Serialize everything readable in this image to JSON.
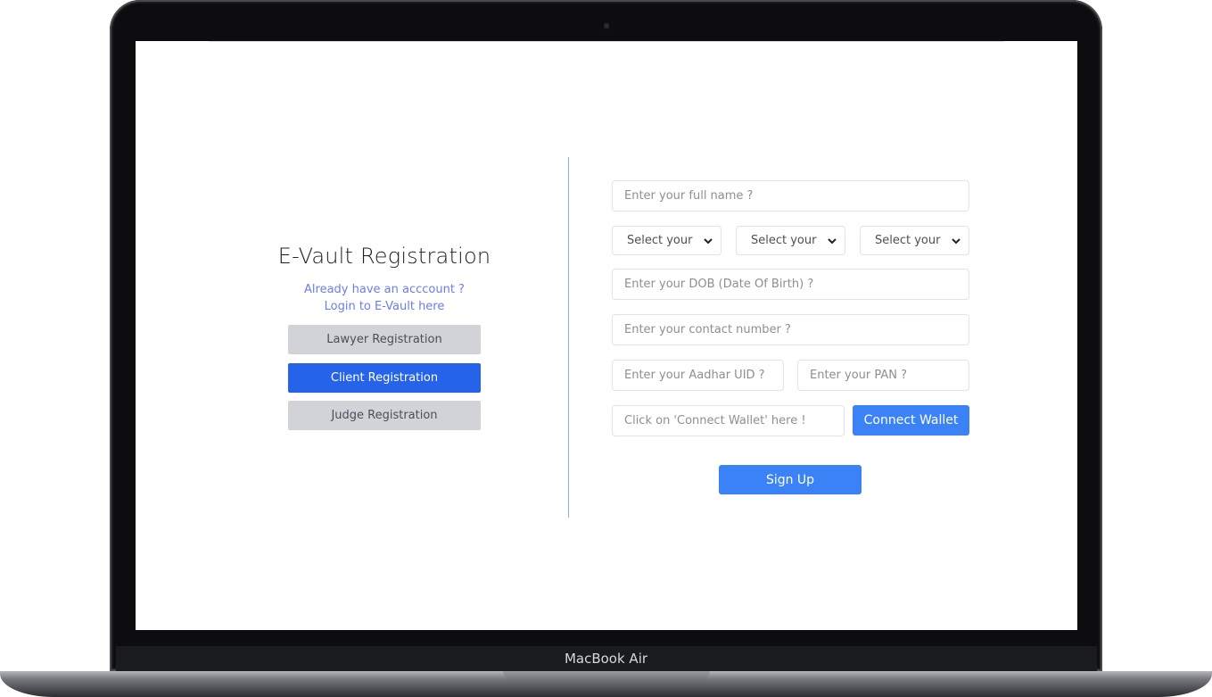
{
  "device": {
    "label": "MacBook Air"
  },
  "registration": {
    "title": "E-Vault Registration",
    "login_line1": "Already have an acccount ?",
    "login_line2": "Login to E-Vault here",
    "roles": [
      {
        "label": "Lawyer Registration",
        "active": false
      },
      {
        "label": "Client Registration",
        "active": true
      },
      {
        "label": "Judge Registration",
        "active": false
      }
    ]
  },
  "form": {
    "full_name_placeholder": "Enter your full name ?",
    "selects": [
      {
        "value": "Select your"
      },
      {
        "value": "Select your"
      },
      {
        "value": "Select your"
      }
    ],
    "dob_placeholder": "Enter your DOB (Date Of Birth) ?",
    "contact_placeholder": "Enter your contact number ?",
    "aadhar_placeholder": "Enter your Aadhar UID ?",
    "pan_placeholder": "Enter your PAN ?",
    "wallet_placeholder": "Click on 'Connect Wallet' here !",
    "connect_wallet_label": "Connect Wallet",
    "signup_label": "Sign Up"
  },
  "colors": {
    "accent": "#2563eb",
    "button": "#3b82f6",
    "link": "#6b7de8",
    "inactive_button": "#d1d3d8"
  }
}
